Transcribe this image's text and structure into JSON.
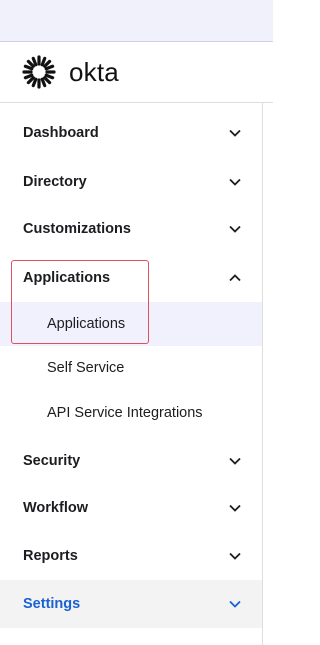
{
  "brand": {
    "name": "okta",
    "logo_icon": "okta-sunburst-icon"
  },
  "nav": {
    "items": [
      {
        "label": "Dashboard",
        "icon": "chevron-down-icon"
      },
      {
        "label": "Directory",
        "icon": "chevron-down-icon"
      },
      {
        "label": "Customizations",
        "icon": "chevron-down-icon"
      },
      {
        "label": "Applications",
        "icon": "chevron-up-icon"
      },
      {
        "label": "Security",
        "icon": "chevron-down-icon"
      },
      {
        "label": "Workflow",
        "icon": "chevron-down-icon"
      },
      {
        "label": "Reports",
        "icon": "chevron-down-icon"
      },
      {
        "label": "Settings",
        "icon": "chevron-down-icon"
      }
    ],
    "applications_subitems": [
      {
        "label": "Applications",
        "active": true
      },
      {
        "label": "Self Service",
        "active": false
      },
      {
        "label": "API Service Integrations",
        "active": false
      }
    ]
  },
  "colors": {
    "accent": "#1a62d2",
    "highlight_border": "#e0505e",
    "active_bg": "#f0f1fc",
    "topbar_bg": "#f1f1fb"
  }
}
